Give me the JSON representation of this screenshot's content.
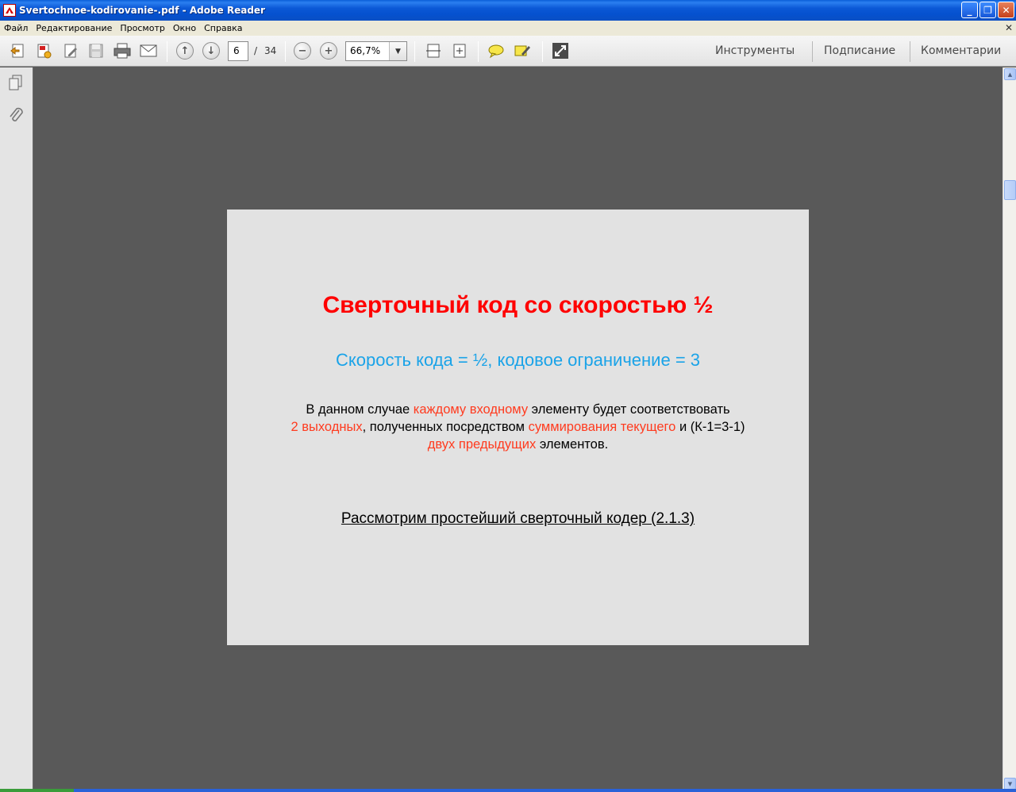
{
  "window": {
    "title": "Svertochnoe-kodirovanie-.pdf - Adobe Reader"
  },
  "menu": [
    "Файл",
    "Редактирование",
    "Просмотр",
    "Окно",
    "Справка"
  ],
  "toolbar": {
    "page_current": "6",
    "page_separator": "/",
    "page_total": "34",
    "zoom": "66,7%",
    "panes": [
      "Инструменты",
      "Подписание",
      "Комментарии"
    ]
  },
  "document": {
    "title": "Сверточный код со скоростью ½",
    "subtitle": "Скорость кода  = ½, кодовое ограничение  = 3",
    "body": {
      "p1a": "В данном случае ",
      "p1b": "каждому входному",
      "p1c": " элементу будет соответствовать",
      "p2a": "2 выходных",
      "p2b": ", полученных посредством ",
      "p2c": "суммирования текущего",
      "p2d": " и (К-1=3-1)",
      "p3a": "двух предыдущих",
      "p3b": " элементов."
    },
    "link": "Рассмотрим простейший сверточный кодер (2.1.3)"
  },
  "colors": {
    "title": "#ff0000",
    "subtitle": "#1aa3e8",
    "highlight": "#ff3b1f",
    "background": "#595959",
    "page": "#e2e2e2"
  }
}
